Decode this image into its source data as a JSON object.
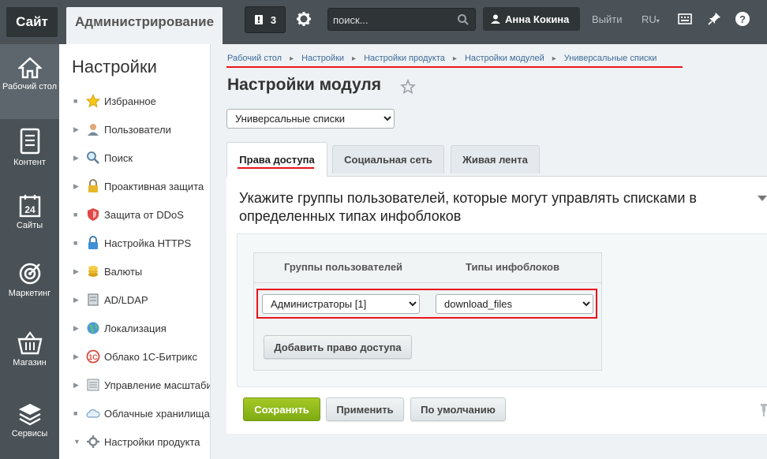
{
  "topbar": {
    "site_tab": "Сайт",
    "admin_tab": "Администрирование",
    "notifications_count": "3",
    "search_placeholder": "поиск...",
    "user_name": "Анна Кокина",
    "logout": "Выйти",
    "language": "RU"
  },
  "leftnav": [
    {
      "label": "Рабочий стол",
      "icon": "home-icon"
    },
    {
      "label": "Контент",
      "icon": "document-icon"
    },
    {
      "label": "Сайты",
      "icon": "calendar-24-icon"
    },
    {
      "label": "Маркетинг",
      "icon": "target-icon"
    },
    {
      "label": "Магазин",
      "icon": "basket-icon"
    },
    {
      "label": "Сервисы",
      "icon": "layers-icon"
    }
  ],
  "sidebar": {
    "title": "Настройки",
    "items": [
      {
        "label": "Избранное",
        "icon": "star-icon",
        "arrow": "none"
      },
      {
        "label": "Пользователи",
        "icon": "user-icon",
        "arrow": "right"
      },
      {
        "label": "Поиск",
        "icon": "magnifier-icon",
        "arrow": "right"
      },
      {
        "label": "Проактивная защита",
        "icon": "lock-icon",
        "arrow": "right"
      },
      {
        "label": "Защита от DDoS",
        "icon": "shield-icon",
        "arrow": "none"
      },
      {
        "label": "Настройка HTTPS",
        "icon": "https-lock-icon",
        "arrow": "none"
      },
      {
        "label": "Валюты",
        "icon": "coins-icon",
        "arrow": "right"
      },
      {
        "label": "AD/LDAP",
        "icon": "server-icon",
        "arrow": "right"
      },
      {
        "label": "Локализация",
        "icon": "globe-icon",
        "arrow": "right"
      },
      {
        "label": "Облако 1С-Битрикс",
        "icon": "cloud-bitrix-icon",
        "arrow": "right"
      },
      {
        "label": "Управление масштабированием",
        "icon": "scale-icon",
        "arrow": "right"
      },
      {
        "label": "Облачные хранилища",
        "icon": "cloud-icon",
        "arrow": "none"
      },
      {
        "label": "Настройки продукта",
        "icon": "gear-icon",
        "arrow": "down"
      }
    ]
  },
  "breadcrumb": [
    "Рабочий стол",
    "Настройки",
    "Настройки продукта",
    "Настройки модулей",
    "Универсальные списки"
  ],
  "main": {
    "page_title": "Настройки модуля",
    "module_select": "Универсальные списки",
    "tabs": [
      {
        "label": "Права доступа",
        "active": true
      },
      {
        "label": "Социальная сеть",
        "active": false
      },
      {
        "label": "Живая лента",
        "active": false
      }
    ],
    "description": "Укажите группы пользователей, которые могут управлять списками в определенных типах инфоблоков",
    "table": {
      "headers": [
        "Группы пользователей",
        "Типы инфоблоков"
      ],
      "rows": [
        {
          "group": "Администраторы [1]",
          "iblock_type": "download_files"
        }
      ],
      "add_button": "Добавить право доступа"
    },
    "buttons": {
      "save": "Сохранить",
      "apply": "Применить",
      "default": "По умолчанию"
    }
  },
  "colors": {
    "topbar_bg": "#4a5257",
    "accent_red": "#e8141b",
    "save_green": "#8db81a",
    "link_blue": "#3e6b99"
  }
}
